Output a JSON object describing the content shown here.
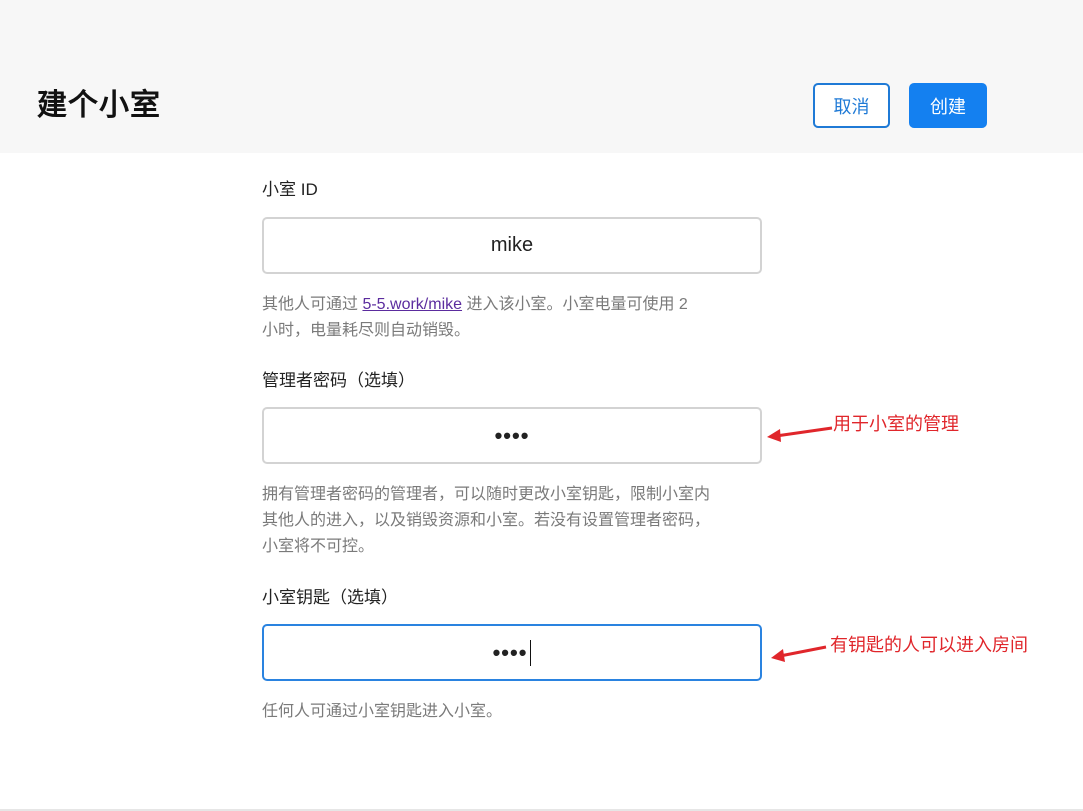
{
  "header": {
    "title": "建个小室",
    "cancel_label": "取消",
    "create_label": "创建"
  },
  "room_id": {
    "label": "小室 ID",
    "value": "mike",
    "help_prefix": "其他人可通过 ",
    "help_link": "5-5.work/mike",
    "help_suffix_line1": " 进入该小室。小室电量可使用 2",
    "help_line2": "小时，电量耗尽则自动销毁。"
  },
  "admin_password": {
    "label": "管理者密码（选填）",
    "value_masked": "••••",
    "help_line1": "拥有管理者密码的管理者，可以随时更改小室钥匙，限制小室内",
    "help_line2": "其他人的进入，以及销毁资源和小室。若没有设置管理者密码，",
    "help_line3": "小室将不可控。"
  },
  "room_key": {
    "label": "小室钥匙（选填）",
    "value_masked": "••••",
    "help": "任何人可通过小室钥匙进入小室。"
  },
  "annotations": {
    "admin_note": "用于小室的管理",
    "key_note": "有钥匙的人可以进入房间",
    "color": "#e0262b"
  }
}
